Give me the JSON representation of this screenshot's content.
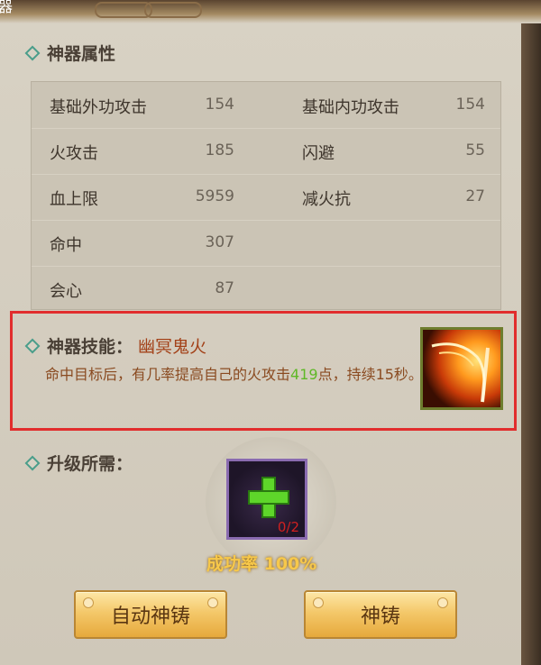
{
  "header": {
    "tab_fragment": "器"
  },
  "attributes": {
    "title": "神器属性",
    "rows": [
      {
        "l_label": "基础外功攻击",
        "l_value": "154",
        "r_label": "基础内功攻击",
        "r_value": "154"
      },
      {
        "l_label": "火攻击",
        "l_value": "185",
        "r_label": "闪避",
        "r_value": "55"
      },
      {
        "l_label": "血上限",
        "l_value": "5959",
        "r_label": "减火抗",
        "r_value": "27"
      },
      {
        "l_label": "命中",
        "l_value": "307",
        "r_label": "",
        "r_value": ""
      },
      {
        "l_label": "会心",
        "l_value": "87",
        "r_label": "",
        "r_value": ""
      }
    ]
  },
  "skill": {
    "title": "神器技能：",
    "name": "幽冥鬼火",
    "desc_part1": "命中目标后，有几率提高自己的火攻击",
    "desc_highlight": "419",
    "desc_part2": "点，持续15秒。",
    "icon": "fire-slash-icon"
  },
  "upgrade": {
    "title": "升级所需：",
    "slot_count": "0/2",
    "success_rate": "成功率 100%"
  },
  "buttons": {
    "auto_forge": "自动神铸",
    "forge": "神铸"
  },
  "colors": {
    "highlight_border": "#e12d2d",
    "accent_teal": "#4a9d8a",
    "gold": "#f7c84a",
    "green_highlight": "#5fb826"
  }
}
